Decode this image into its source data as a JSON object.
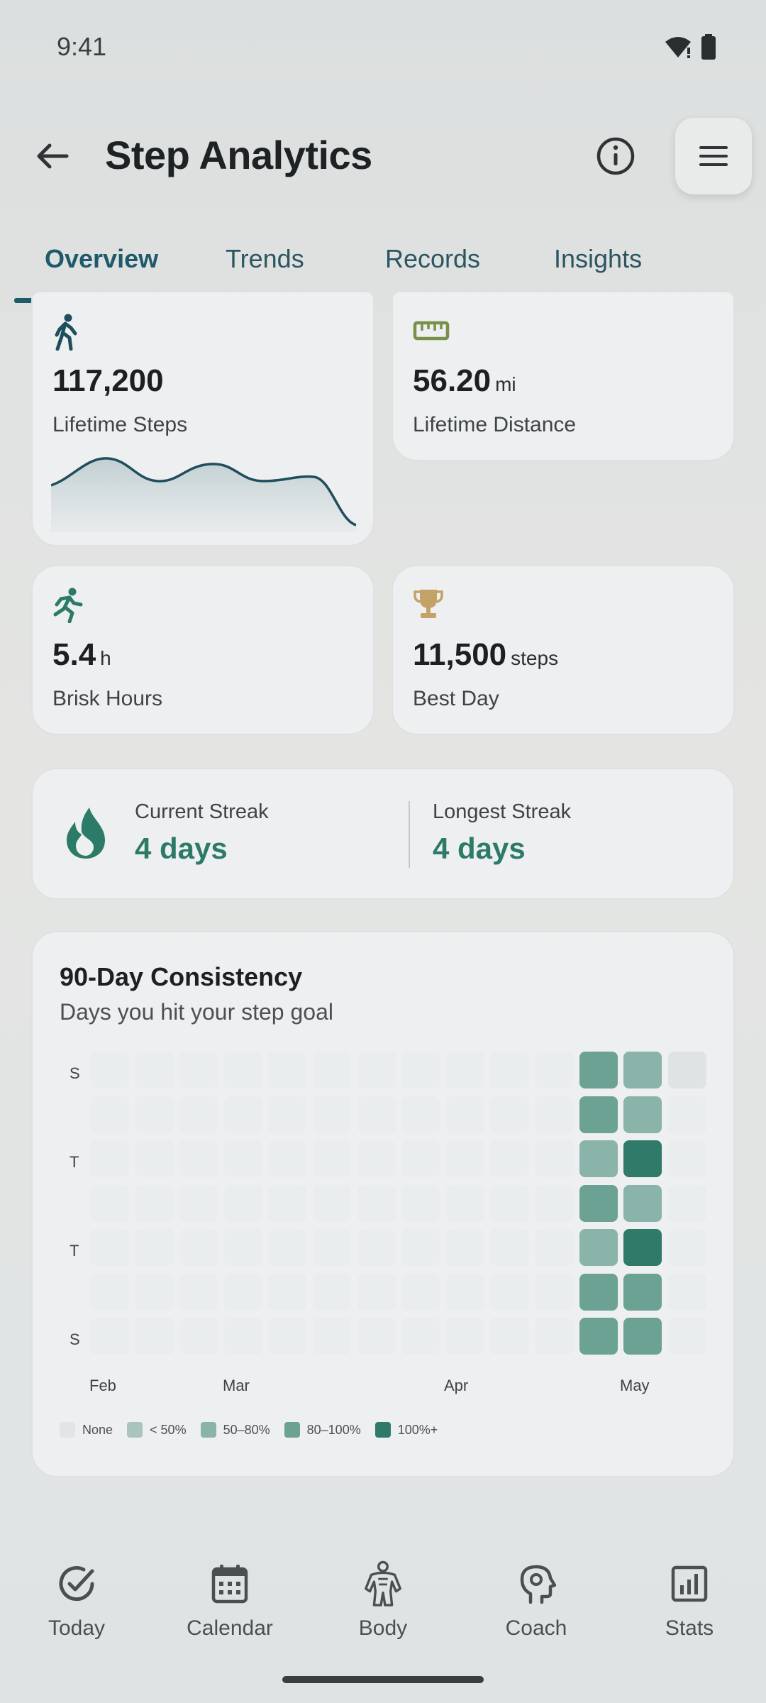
{
  "status_bar": {
    "time": "9:41"
  },
  "app_bar": {
    "title": "Step Analytics"
  },
  "tabs": [
    {
      "label": "Overview",
      "active": true
    },
    {
      "label": "Trends",
      "active": false
    },
    {
      "label": "Records",
      "active": false
    },
    {
      "label": "Insights",
      "active": false
    }
  ],
  "stats": {
    "lifetime_steps": {
      "value": "117,200",
      "unit": "",
      "label": "Lifetime Steps",
      "icon": "walking-icon"
    },
    "lifetime_distance": {
      "value": "56.20",
      "unit": "mi",
      "label": "Lifetime Distance",
      "icon": "ruler-icon"
    },
    "brisk_hours": {
      "value": "5.4",
      "unit": "h",
      "label": "Brisk Hours",
      "icon": "running-icon"
    },
    "best_day": {
      "value": "11,500",
      "unit": "steps",
      "label": "Best Day",
      "icon": "trophy-icon"
    }
  },
  "streak": {
    "current_label": "Current Streak",
    "current_value": "4 days",
    "longest_label": "Longest Streak",
    "longest_value": "4 days",
    "icon": "flame-icon"
  },
  "consistency": {
    "title": "90-Day Consistency",
    "subtitle": "Days you hit your step goal",
    "day_labels": [
      "S",
      "T",
      "T",
      "S"
    ],
    "month_labels": [
      "Feb",
      "Mar",
      "Apr",
      "May"
    ],
    "legend": [
      {
        "label": "None",
        "color": "#e2e5e5"
      },
      {
        "label": "< 50%",
        "color": "#a9c3bd"
      },
      {
        "label": "50–80%",
        "color": "#8ab4aa"
      },
      {
        "label": "80–100%",
        "color": "#6ca293"
      },
      {
        "label": "100%+",
        "color": "#2f7a68"
      }
    ],
    "active_weeks": [
      {
        "week": 11,
        "levels": [
          3,
          3,
          2,
          3,
          2,
          3,
          3
        ]
      },
      {
        "week": 12,
        "levels": [
          2,
          2,
          4,
          2,
          4,
          3,
          3
        ]
      }
    ]
  },
  "bottom_nav": [
    {
      "label": "Today",
      "icon": "check-circle-icon"
    },
    {
      "label": "Calendar",
      "icon": "calendar-icon"
    },
    {
      "label": "Body",
      "icon": "body-icon"
    },
    {
      "label": "Coach",
      "icon": "coach-icon"
    },
    {
      "label": "Stats",
      "icon": "stats-icon"
    }
  ],
  "colors": {
    "accent": "#1e5a6b",
    "streak_green": "#2c7a68",
    "trophy": "#c4a267",
    "ruler": "#7a8f4a"
  }
}
